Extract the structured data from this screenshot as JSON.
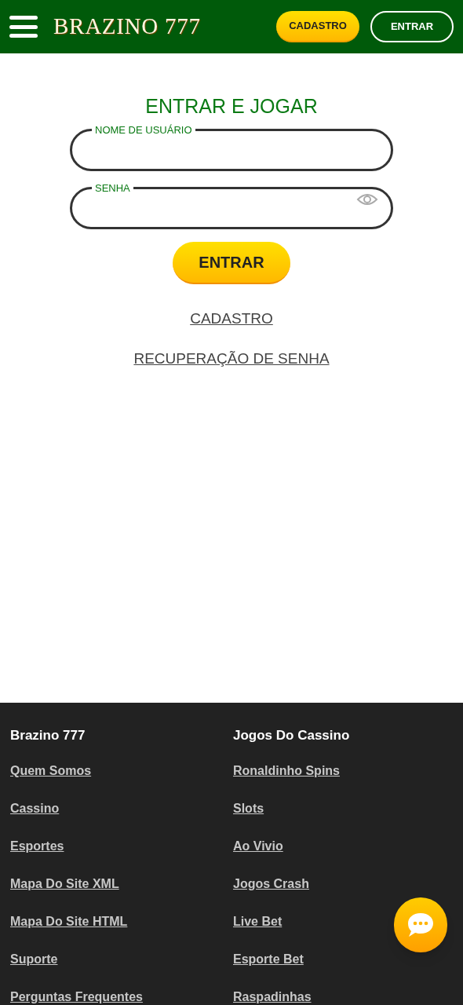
{
  "header": {
    "logo": "BRAZINO 777",
    "buttons": [
      {
        "kind": "primary",
        "label": "CADASTRO"
      },
      {
        "kind": "outline",
        "label": "ENTRAR"
      }
    ]
  },
  "login": {
    "title": "ENTRAR E JOGAR",
    "fields": [
      {
        "kind": "text",
        "label": "NOME DE USUÁRIO"
      },
      {
        "kind": "password",
        "label": "SENHA"
      }
    ],
    "submit": "ENTRAR",
    "links": [
      "CADASTRO",
      "RECUPERAÇÃO DE SENHA"
    ]
  },
  "footer": {
    "columns": [
      {
        "title": "Brazino 777",
        "links": [
          "Quem Somos",
          "Cassino",
          "Esportes",
          "Mapa Do Site XML",
          "Mapa Do Site HTML",
          "Suporte",
          "Perguntas Frequentes"
        ]
      },
      {
        "title": "Jogos Do Cassino",
        "links": [
          "Ronaldinho Spins",
          "Slots",
          "Ao Vivio",
          "Jogos Crash",
          "Live Bet",
          "Esporte Bet",
          "Raspadinhas"
        ]
      }
    ]
  }
}
